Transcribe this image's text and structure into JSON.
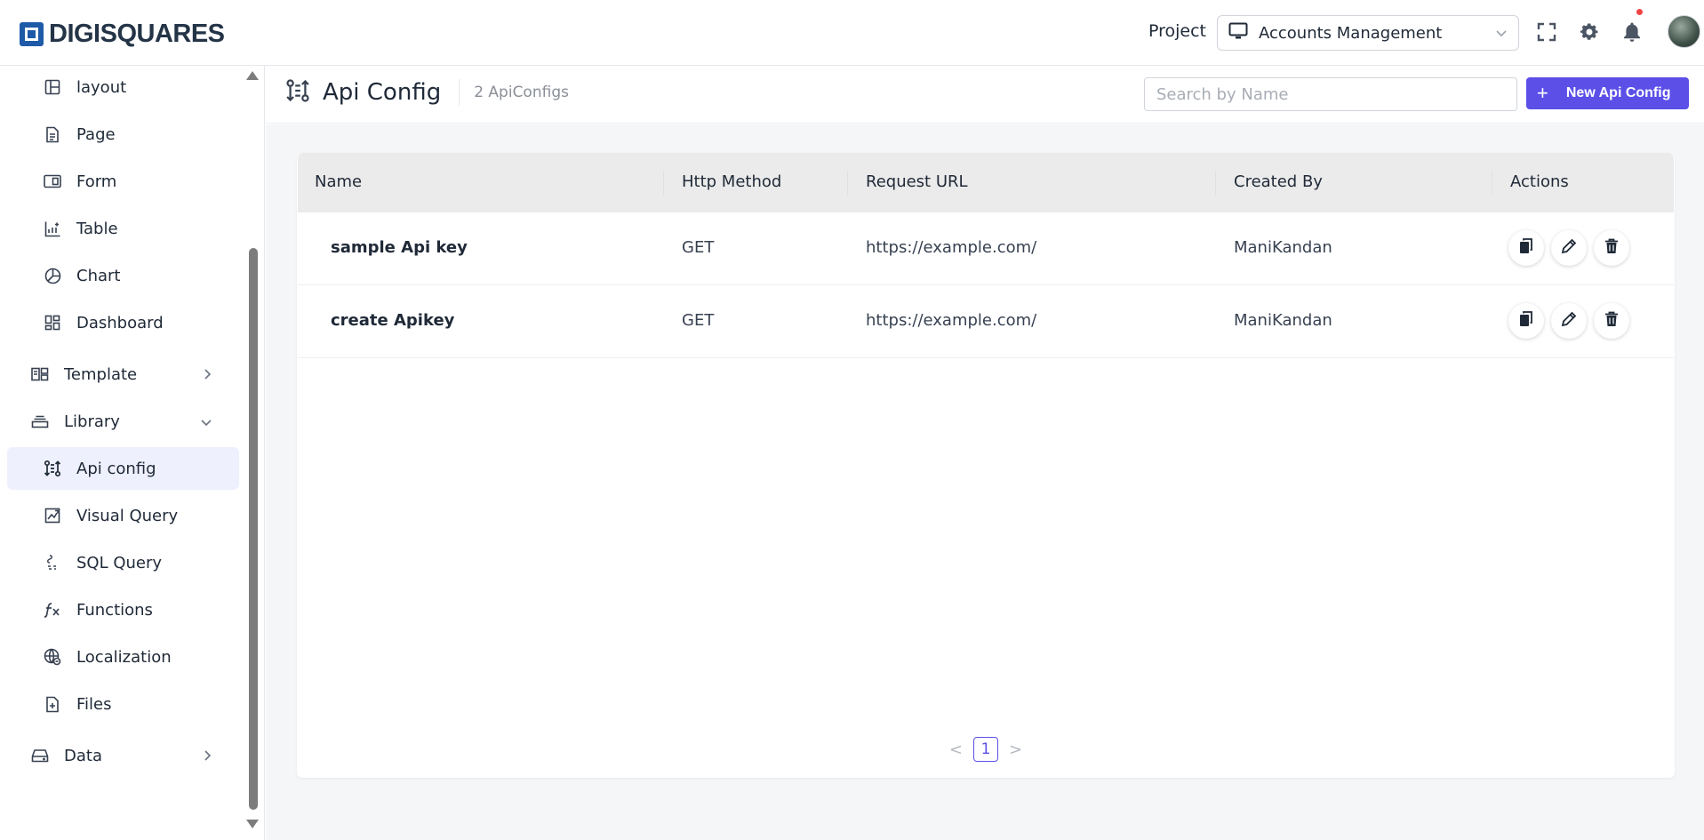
{
  "brand": {
    "name": "DIGISQUARES"
  },
  "header": {
    "project_label": "Project",
    "project_value": "Accounts Management",
    "icons": [
      "fullscreen-icon",
      "gear-icon",
      "bell-icon",
      "avatar"
    ]
  },
  "sidebar": {
    "items": [
      {
        "label": "layout",
        "icon": "layout-icon"
      },
      {
        "label": "Page",
        "icon": "page-icon"
      },
      {
        "label": "Form",
        "icon": "form-icon"
      },
      {
        "label": "Table",
        "icon": "table-icon"
      },
      {
        "label": "Chart",
        "icon": "chart-icon"
      },
      {
        "label": "Dashboard",
        "icon": "dashboard-icon"
      }
    ],
    "groups": [
      {
        "label": "Template",
        "icon": "template-icon",
        "expanded": false
      },
      {
        "label": "Library",
        "icon": "library-icon",
        "expanded": true
      },
      {
        "label": "Data",
        "icon": "data-icon",
        "expanded": false
      }
    ],
    "library_items": [
      {
        "label": "Api config",
        "icon": "api-config-icon",
        "active": true
      },
      {
        "label": "Visual Query",
        "icon": "visual-query-icon"
      },
      {
        "label": "SQL Query",
        "icon": "sql-query-icon"
      },
      {
        "label": "Functions",
        "icon": "functions-icon"
      },
      {
        "label": "Localization",
        "icon": "globe-icon"
      },
      {
        "label": "Files",
        "icon": "file-icon"
      }
    ]
  },
  "page": {
    "title": "Api Config",
    "count": "2 ApiConfigs",
    "search_placeholder": "Search by Name",
    "new_button": "New Api Config"
  },
  "table": {
    "columns": [
      "Name",
      "Http Method",
      "Request URL",
      "Created By",
      "Actions"
    ],
    "rows": [
      {
        "name": "sample Api key",
        "method": "GET",
        "url": "https://example.com/",
        "created_by": "ManiKandan"
      },
      {
        "name": "create Apikey",
        "method": "GET",
        "url": "https://example.com/",
        "created_by": "ManiKandan"
      }
    ],
    "row_actions": [
      "copy-icon",
      "pencil-icon",
      "trash-icon"
    ]
  },
  "pagination": {
    "current": "1",
    "prev": "<",
    "next": ">"
  },
  "colors": {
    "accent": "#5b4fe8",
    "active_bg": "#eef0fe",
    "header_bg": "#ebebeb"
  }
}
